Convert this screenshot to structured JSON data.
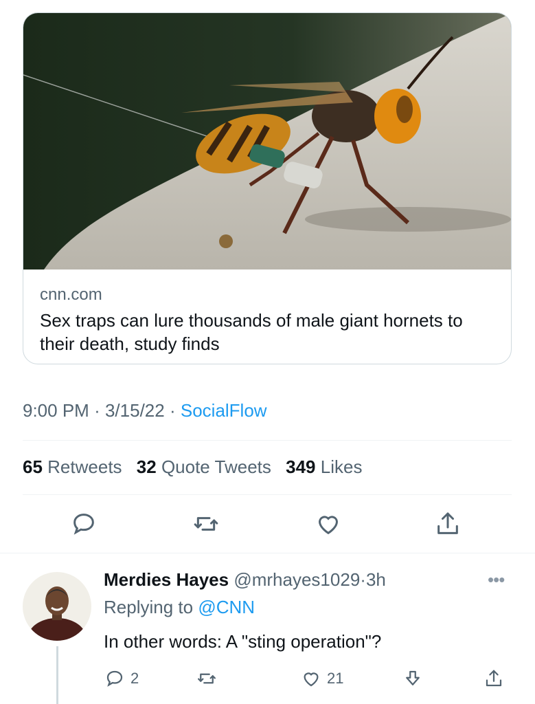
{
  "card": {
    "image": "hornet-photo",
    "domain": "cnn.com",
    "title": "Sex traps can lure thousands of male giant hornets to their death, study finds"
  },
  "tweet": {
    "time": "9:00 PM",
    "date": "3/15/22",
    "source": "SocialFlow",
    "retweets_count": "65",
    "retweets_label": "Retweets",
    "quotes_count": "32",
    "quotes_label": "Quote Tweets",
    "likes_count": "349",
    "likes_label": "Likes",
    "separator": "·",
    "actions": [
      "reply-icon",
      "retweet-icon",
      "like-icon",
      "share-icon"
    ]
  },
  "reply": {
    "name": "Merdies Hayes",
    "handle": "@mrhayes1029",
    "separator": "·",
    "age": "3h",
    "more": "•••",
    "replying_prefix": "Replying to",
    "replying_to": "@CNN",
    "text": "In other words: A \"sting operation\"?",
    "reply_count": "2",
    "like_count": "21"
  },
  "colors": {
    "link": "#1d9bf0",
    "secondary_text": "#536471",
    "primary_text": "#0f1419",
    "border": "#cfd9de"
  }
}
